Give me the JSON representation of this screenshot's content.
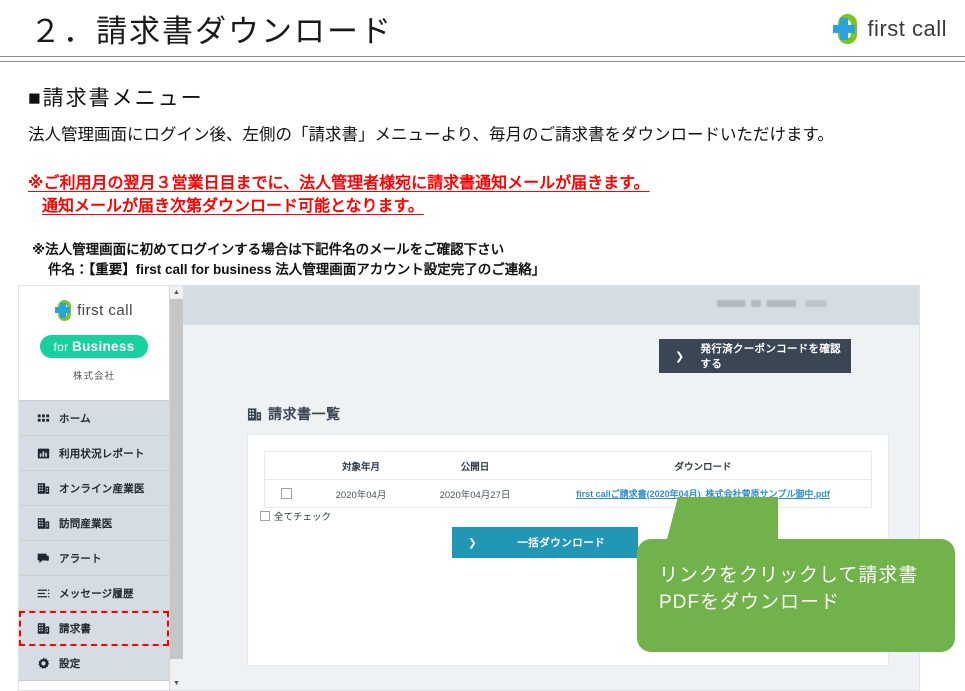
{
  "slide": {
    "title": "２．請求書ダウンロード",
    "brand": "first call",
    "section_heading": "■請求書メニュー",
    "paragraph": "法人管理画面にログイン後、左側の「請求書」メニューより、毎月のご請求書をダウンロードいただけます。",
    "warning_line1": "※ご利用月の翌月３営業日目までに、法人管理者様宛に請求書通知メールが届きます。",
    "warning_line2": "通知メールが届き次第ダウンロード可能となります。",
    "note_line1": "※法人管理画面に初めてログインする場合は下記件名のメールをご確認下さい",
    "note_line2": "件名：【重要】first call for business 法人管理画面アカウント設定完了のご連絡」",
    "warning_color": "#ff0000",
    "callout_color": "#72b24a"
  },
  "callout": {
    "line1": "リンクをクリックして請求書",
    "line2": "PDFをダウンロード"
  },
  "app": {
    "sidebar": {
      "logo_text": "first call",
      "badge_prefix": "for ",
      "badge_main": "Business",
      "company": "株式会社",
      "items": [
        {
          "label": "ホーム",
          "icon": "grid-icon",
          "selected": false
        },
        {
          "label": "利用状況レポート",
          "icon": "bar-chart-icon",
          "selected": false
        },
        {
          "label": "オンライン産業医",
          "icon": "building-icon",
          "selected": false
        },
        {
          "label": "訪問産業医",
          "icon": "building-icon",
          "selected": false
        },
        {
          "label": "アラート",
          "icon": "chat-icon",
          "selected": false
        },
        {
          "label": "メッセージ履歴",
          "icon": "list-icon",
          "selected": false
        },
        {
          "label": "請求書",
          "icon": "building-icon",
          "selected": true
        },
        {
          "label": "設定",
          "icon": "gear-icon",
          "selected": false
        }
      ]
    },
    "coupon_button": {
      "chevron": "❯",
      "label": "発行済クーポンコードを確認する"
    },
    "list_title": "請求書一覧",
    "table": {
      "headers": [
        "",
        "対象年月",
        "公開日",
        "ダウンロード"
      ],
      "rows": [
        {
          "checked": false,
          "target_month": "2020年04月",
          "published": "2020年04月27日",
          "file": "first callご請求書(2020年04月)_株式会社菅原サンプル御中.pdf"
        }
      ]
    },
    "check_all_label": "全てチェック",
    "bulk_button": {
      "chevron": "❯",
      "label": "一括ダウンロード"
    }
  }
}
